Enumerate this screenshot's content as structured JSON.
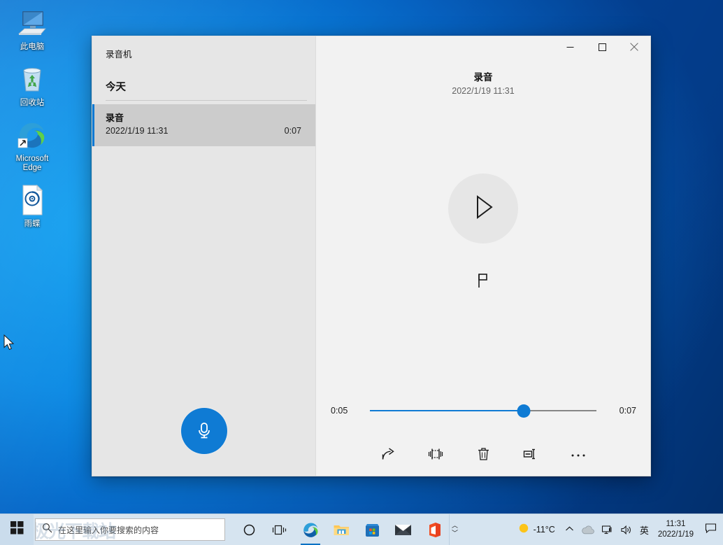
{
  "desktop": {
    "icons": [
      {
        "label": "此电脑",
        "icon": "this-pc-icon"
      },
      {
        "label": "回收站",
        "icon": "recycle-bin-icon"
      },
      {
        "label": "Microsoft Edge",
        "icon": "microsoft-edge-icon"
      },
      {
        "label": "雨蝶",
        "icon": "media-file-icon"
      }
    ]
  },
  "window": {
    "app_title": "录音机",
    "controls": {
      "minimize": "minimize-icon",
      "maximize": "maximize-icon",
      "close": "close-icon"
    },
    "left": {
      "group_header": "今天",
      "recordings": [
        {
          "name": "录音",
          "date": "2022/1/19 11:31",
          "duration": "0:07",
          "selected": true
        }
      ],
      "record_button": "record-microphone-icon"
    },
    "detail": {
      "title": "录音",
      "date": "2022/1/19 11:31",
      "play_button": "play-icon",
      "flag_button": "flag-marker-icon",
      "seek": {
        "current_time": "0:05",
        "total_time": "0:07",
        "progress_percent": 68
      },
      "commands": [
        {
          "name": "share-button",
          "icon": "share-icon"
        },
        {
          "name": "trim-button",
          "icon": "trim-icon"
        },
        {
          "name": "delete-button",
          "icon": "trash-icon"
        },
        {
          "name": "rename-button",
          "icon": "rename-icon"
        },
        {
          "name": "more-button",
          "icon": "ellipsis-icon"
        }
      ]
    }
  },
  "taskbar": {
    "start": "windows-start-icon",
    "search": {
      "placeholder": "在这里输入你要搜索的内容",
      "icon": "search-icon",
      "watermark": "极光下载站"
    },
    "pinned": [
      {
        "name": "cortana-icon",
        "active": false
      },
      {
        "name": "task-view-icon",
        "active": false
      },
      {
        "name": "microsoft-edge-icon",
        "active": true
      },
      {
        "name": "file-explorer-icon",
        "active": false
      },
      {
        "name": "microsoft-store-icon",
        "active": false
      },
      {
        "name": "mail-icon",
        "active": false
      },
      {
        "name": "office-icon",
        "active": false
      }
    ],
    "tray": {
      "weather_temp": "-11°C",
      "weather_icon": "sun-icon",
      "show_hidden": "chevron-up-icon",
      "onedrive": "cloud-icon",
      "network": "network-icon",
      "volume": "speaker-icon",
      "ime": "英",
      "time": "11:31",
      "date": "2022/1/19",
      "action_center": "notification-icon"
    }
  },
  "colors": {
    "accent": "#0f7bd4",
    "window_bg": "#f2f2f2",
    "left_pane_bg": "#e6e6e6",
    "selected_item_bg": "#cccccc",
    "taskbar_bg": "#d6e4f0"
  }
}
